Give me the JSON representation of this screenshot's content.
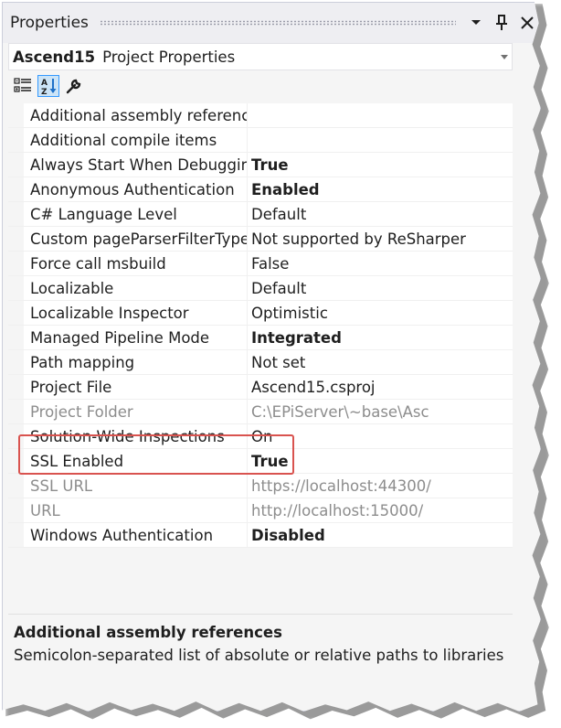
{
  "panel": {
    "title": "Properties",
    "object_name": "Ascend15",
    "object_type": "Project Properties"
  },
  "toolbar": {
    "icons": [
      "categorized-icon",
      "alphabetical-sort-icon",
      "property-pages-wrench-icon"
    ]
  },
  "properties": [
    {
      "name": "Additional assembly references",
      "value": "",
      "bold": false,
      "readonly": false
    },
    {
      "name": "Additional compile items",
      "value": "",
      "bold": false,
      "readonly": false
    },
    {
      "name": "Always Start When Debugging",
      "value": "True",
      "bold": true,
      "readonly": false
    },
    {
      "name": "Anonymous Authentication",
      "value": "Enabled",
      "bold": true,
      "readonly": false
    },
    {
      "name": "C# Language Level",
      "value": "Default",
      "bold": false,
      "readonly": false
    },
    {
      "name": "Custom pageParserFilterType",
      "value": "Not supported by ReSharper",
      "bold": false,
      "readonly": false
    },
    {
      "name": "Force call msbuild",
      "value": "False",
      "bold": false,
      "readonly": false
    },
    {
      "name": "Localizable",
      "value": "Default",
      "bold": false,
      "readonly": false
    },
    {
      "name": "Localizable Inspector",
      "value": "Optimistic",
      "bold": false,
      "readonly": false
    },
    {
      "name": "Managed Pipeline Mode",
      "value": "Integrated",
      "bold": true,
      "readonly": false
    },
    {
      "name": "Path mapping",
      "value": "Not set",
      "bold": false,
      "readonly": false
    },
    {
      "name": "Project File",
      "value": "Ascend15.csproj",
      "bold": false,
      "readonly": false
    },
    {
      "name": "Project Folder",
      "value": "C:\\EPiServer\\~base\\Asc",
      "bold": false,
      "readonly": true
    },
    {
      "name": "Solution-Wide Inspections",
      "value": "On",
      "bold": false,
      "readonly": false
    },
    {
      "name": "SSL Enabled",
      "value": "True",
      "bold": true,
      "readonly": false
    },
    {
      "name": "SSL URL",
      "value": "https://localhost:44300/",
      "bold": false,
      "readonly": true
    },
    {
      "name": "URL",
      "value": "http://localhost:15000/",
      "bold": false,
      "readonly": true
    },
    {
      "name": "Windows Authentication",
      "value": "Disabled",
      "bold": true,
      "readonly": false
    }
  ],
  "description": {
    "title": "Additional assembly references",
    "text": "Semicolon-separated list of absolute or relative paths to libraries t..."
  },
  "colors": {
    "highlight": "#d9534f",
    "accent": "#3399ff",
    "readonly_text": "#8d8d8d"
  }
}
